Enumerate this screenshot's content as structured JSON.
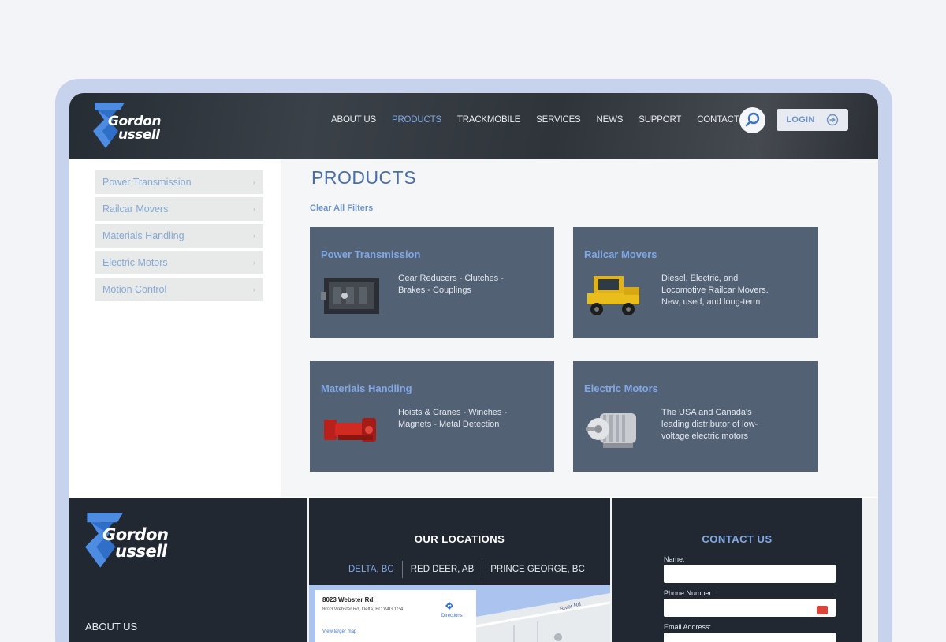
{
  "header": {
    "logo_top": "Gordon",
    "logo_bottom": "ussell",
    "nav": [
      {
        "label": "ABOUT US",
        "active": false
      },
      {
        "label": "PRODUCTS",
        "active": true
      },
      {
        "label": "TRACKMOBILE",
        "active": false
      },
      {
        "label": "SERVICES",
        "active": false
      },
      {
        "label": "NEWS",
        "active": false
      },
      {
        "label": "SUPPORT",
        "active": false
      },
      {
        "label": "CONTACT US",
        "active": false
      }
    ],
    "login_label": "LOGIN"
  },
  "sidebar": {
    "items": [
      {
        "label": "Power Transmission"
      },
      {
        "label": "Railcar Movers"
      },
      {
        "label": "Materials Handling"
      },
      {
        "label": "Electric Motors"
      },
      {
        "label": "Motion Control"
      }
    ]
  },
  "main": {
    "title": "PRODUCTS",
    "clear_filters": "Clear All Filters",
    "cards": [
      {
        "title": "Power Transmission",
        "description": "Gear Reducers - Clutches - Brakes - Couplings",
        "icon": "gearbox-image"
      },
      {
        "title": "Railcar Movers",
        "description": "Diesel, Electric, and Locomotive Railcar Movers. New, used, and long-term",
        "icon": "railcar-mover-image"
      },
      {
        "title": "Materials Handling",
        "description": "Hoists & Cranes - Winches - Magnets - Metal Detection",
        "icon": "winch-image"
      },
      {
        "title": "Electric Motors",
        "description": "The USA and Canada's leading distributor of low-voltage electric motors",
        "icon": "electric-motor-image"
      }
    ]
  },
  "footer": {
    "logo_top": "Gordon",
    "logo_bottom": "ussell",
    "about_label": "ABOUT US",
    "locations_title": "OUR LOCATIONS",
    "locations": [
      {
        "label": "DELTA, BC",
        "active": true
      },
      {
        "label": "RED DEER, AB",
        "active": false
      },
      {
        "label": "PRINCE GEORGE, BC",
        "active": false
      }
    ],
    "map": {
      "address_title": "8023 Webster Rd",
      "address_line": "8023 Webster Rd, Delta, BC V4G 1G4",
      "directions": "Directions",
      "larger_map": "View larger map",
      "road_label": "River Rd"
    },
    "contact_title": "CONTACT US",
    "fields": [
      {
        "label": "Name:",
        "value": ""
      },
      {
        "label": "Phone Number:",
        "value": ""
      },
      {
        "label": "Email Address:",
        "value": ""
      }
    ]
  },
  "colors": {
    "accent": "#7fa8e6",
    "card_bg": "#536175",
    "header_bg": "#2e343a",
    "footer_bg": "#222831"
  }
}
